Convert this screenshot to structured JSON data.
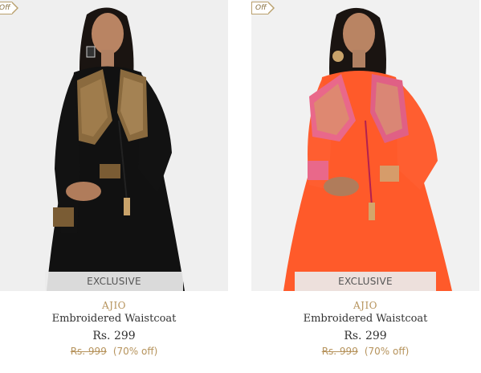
{
  "colors": {
    "accent": "#b6935c",
    "text": "#333333",
    "photo_bg": "#efefef"
  },
  "products": [
    {
      "offer_tag": "Off",
      "badge": "EXCLUSIVE",
      "brand": "AJIO",
      "name": "Embroidered Waistcoat",
      "price": "Rs. 299",
      "original_price": "Rs. 999",
      "discount": "(70% off)",
      "image_icon": "product-photo-black-kurta-with-waistcoat"
    },
    {
      "offer_tag": "Off",
      "badge": "EXCLUSIVE",
      "brand": "AJIO",
      "name": "Embroidered Waistcoat",
      "price": "Rs. 299",
      "original_price": "Rs. 999",
      "discount": "(70% off)",
      "image_icon": "product-photo-orange-kurta-with-waistcoat"
    }
  ]
}
